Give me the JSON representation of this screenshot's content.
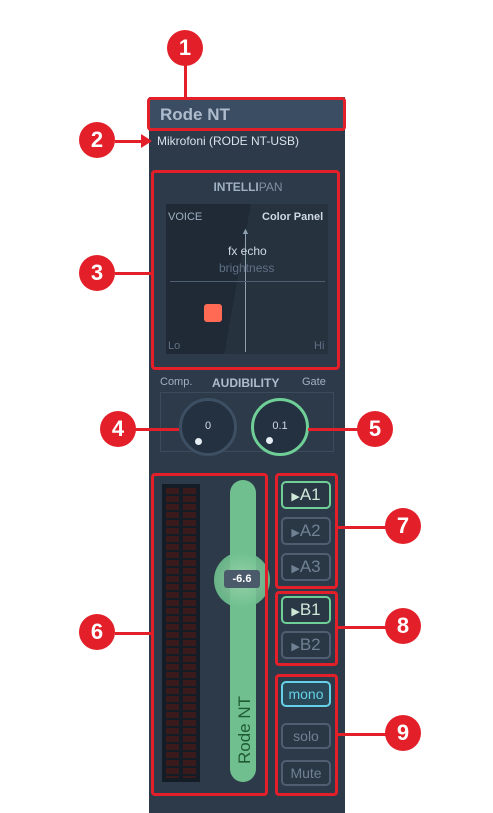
{
  "strip": {
    "title": "Rode NT",
    "device": "Mikrofoni (RODE NT-USB)"
  },
  "intellipan": {
    "title_bold": "INTELLI",
    "title_light": "PAN",
    "voice_label": "VOICE",
    "color_panel_label": "Color Panel",
    "fx_label": "fx echo",
    "brightness_label": "brightness",
    "lo_label": "Lo",
    "hi_label": "Hi"
  },
  "audibility": {
    "comp_label": "Comp.",
    "title": "AUDIBILITY",
    "gate_label": "Gate",
    "comp_value": "0",
    "gate_value": "0.1"
  },
  "fader": {
    "value": "-6.6",
    "name": "Rode NT"
  },
  "buses": {
    "a": [
      "A1",
      "A2",
      "A3"
    ],
    "b": [
      "B1",
      "B2"
    ]
  },
  "options": {
    "mono": "mono",
    "solo": "solo",
    "mute": "Mute"
  },
  "annotations": [
    "1",
    "2",
    "3",
    "4",
    "5",
    "6",
    "7",
    "8",
    "9"
  ],
  "colors": {
    "annotation": "#e3202a",
    "strip_bg": "#2d3a4a",
    "active_green": "#6fcf97",
    "mono_cyan": "#64d1e8"
  }
}
